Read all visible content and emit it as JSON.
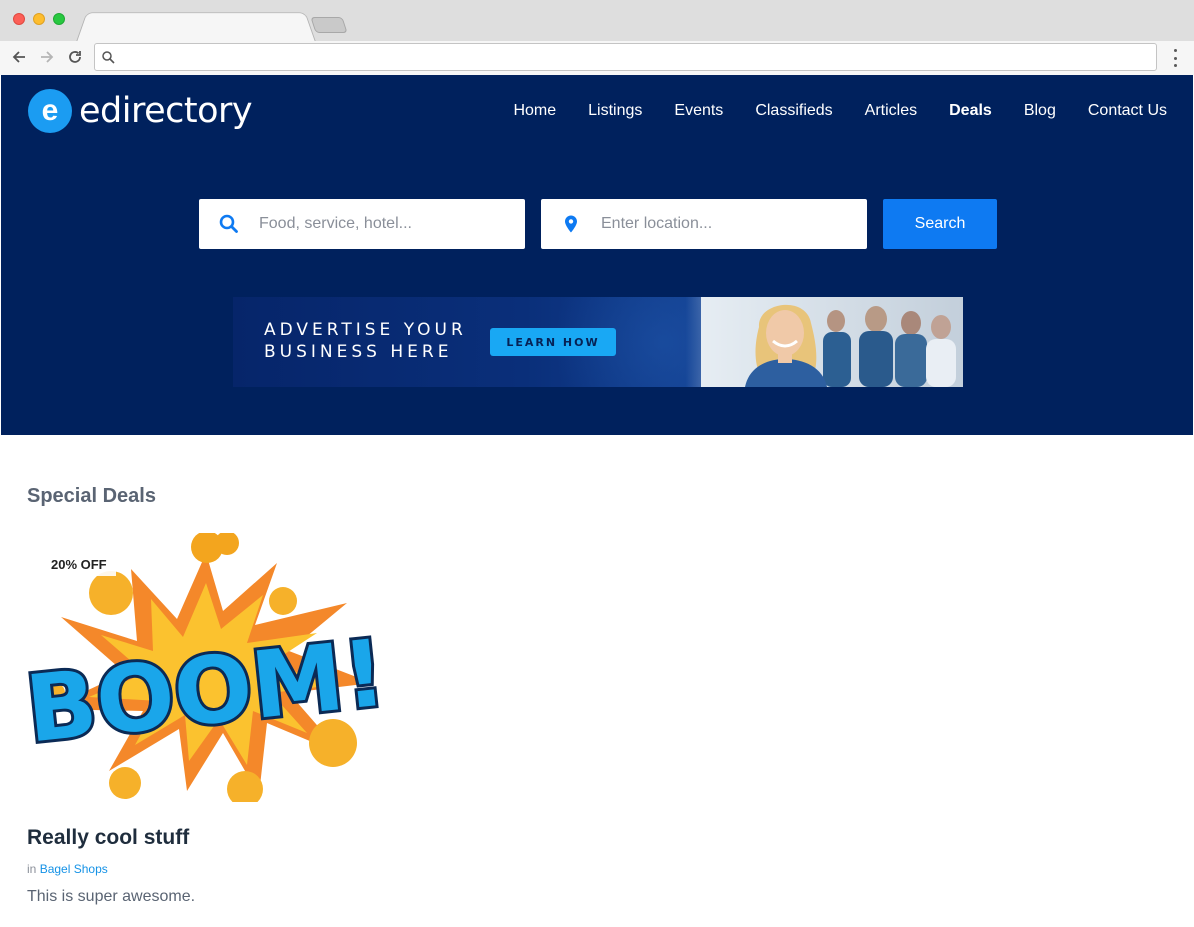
{
  "browser": {
    "tab_title": "",
    "address": ""
  },
  "site": {
    "logo_text": "edirectory",
    "logo_mark": "e",
    "nav": [
      {
        "label": "Home"
      },
      {
        "label": "Listings"
      },
      {
        "label": "Events"
      },
      {
        "label": "Classifieds"
      },
      {
        "label": "Articles"
      },
      {
        "label": "Deals",
        "active": true
      },
      {
        "label": "Blog"
      },
      {
        "label": "Contact Us"
      }
    ]
  },
  "search": {
    "keyword_placeholder": "Food, service, hotel...",
    "location_placeholder": "Enter location...",
    "button_label": "Search"
  },
  "banner": {
    "line1": "ADVERTISE YOUR",
    "line2": "BUSINESS HERE",
    "button_label": "LEARN HOW"
  },
  "content": {
    "section_title": "Special Deals",
    "deal": {
      "badge": "20% OFF",
      "image_text": "BOOM!",
      "title": "Really cool stuff",
      "category_prefix": "in",
      "category": "Bagel Shops",
      "description": "This is super awesome."
    }
  },
  "colors": {
    "header_bg": "#00215d",
    "accent_blue": "#0e7af2",
    "logo_blue": "#1b9cf2"
  },
  "icons": {
    "back": "arrow-left-icon",
    "forward": "arrow-right-icon",
    "reload": "reload-icon",
    "omnibox": "search-icon",
    "menu": "kebab-menu-icon",
    "keyword": "search-icon",
    "location": "map-pin-icon"
  }
}
